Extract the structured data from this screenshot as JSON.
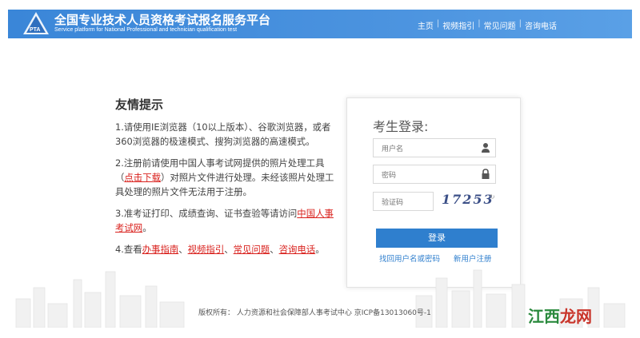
{
  "header": {
    "title_cn": "全国专业技术人员资格考试报名服务平台",
    "title_en": "Service platform for National Professional and technician qualification test",
    "logo_text": "PTA",
    "nav": [
      "主页",
      "视频指引",
      "常见问题",
      "咨询电话"
    ]
  },
  "tips": {
    "title": "友情提示",
    "item1": "1.请使用IE浏览器（10以上版本）、谷歌浏览器，或者360浏览器的极速模式、搜狗浏览器的高速模式。",
    "item2_pre": "2.注册前请使用中国人事考试网提供的照片处理工具（",
    "item2_link": "点击下载",
    "item2_post": "）对照片文件进行处理。未经该照片处理工具处理的照片文件无法用于注册。",
    "item3_pre": "3.准考证打印、成绩查询、证书查验等请访问",
    "item3_link": "中国人事考试网",
    "item3_post": "。",
    "item4_pre": "4.查看",
    "item4_links": [
      "办事指南",
      "视频指引",
      "常见问题",
      "咨询电话"
    ],
    "item4_sep": "、",
    "item4_post": "。"
  },
  "login": {
    "title": "考生登录:",
    "username_placeholder": "用户名",
    "password_placeholder": "密码",
    "captcha_placeholder": "验证码",
    "captcha_code": "17253",
    "captcha_refresh": "↻",
    "login_button": "登录",
    "forgot_link": "找回用户名或密码",
    "register_link": "新用户注册"
  },
  "footer": {
    "copyright": "版权所有：  人力资源和社会保障部人事考试中心 京ICP备13013060号-1"
  },
  "watermark": {
    "text_pre": "江西",
    "text_post": "龙网"
  },
  "colors": {
    "header_bg": "#3a86d8",
    "link_red": "#d9211d",
    "button_blue": "#2f7fce"
  }
}
